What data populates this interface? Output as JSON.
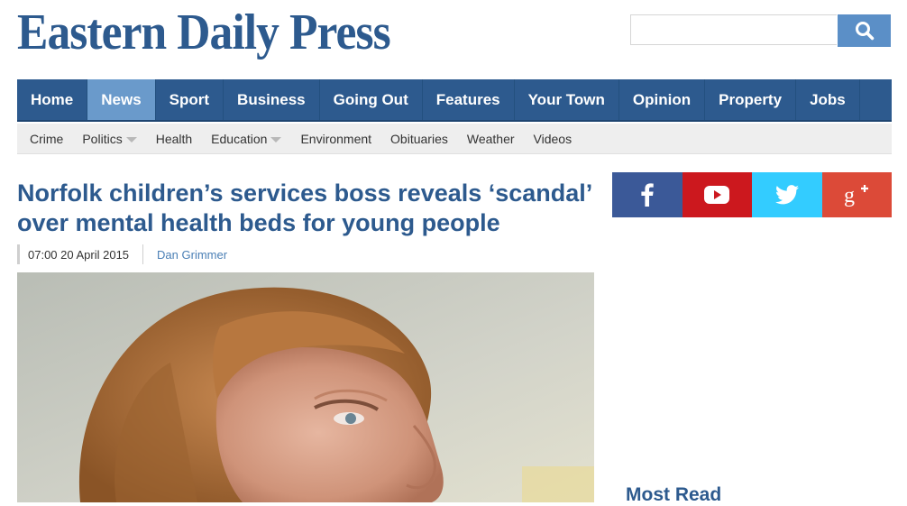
{
  "site": {
    "logo_text": "Eastern Daily Press"
  },
  "search": {
    "placeholder": "",
    "button_icon": "search-icon"
  },
  "main_nav": {
    "items": [
      {
        "label": "Home"
      },
      {
        "label": "News",
        "active": true
      },
      {
        "label": "Sport"
      },
      {
        "label": "Business"
      },
      {
        "label": "Going Out"
      },
      {
        "label": "Features"
      },
      {
        "label": "Your Town"
      },
      {
        "label": "Opinion"
      },
      {
        "label": "Property"
      },
      {
        "label": "Jobs"
      }
    ]
  },
  "sub_nav": {
    "items": [
      {
        "label": "Crime"
      },
      {
        "label": "Politics",
        "has_dropdown": true
      },
      {
        "label": "Health"
      },
      {
        "label": "Education",
        "has_dropdown": true
      },
      {
        "label": "Environment"
      },
      {
        "label": "Obituaries"
      },
      {
        "label": "Weather"
      },
      {
        "label": "Videos"
      }
    ]
  },
  "article": {
    "headline": "Norfolk children’s services boss reveals ‘scandal’ over mental health beds for young people",
    "date": "07:00 20 April 2015",
    "author": "Dan Grimmer"
  },
  "social": {
    "buttons": [
      {
        "name": "facebook",
        "icon": "facebook-icon",
        "color": "#3b5998"
      },
      {
        "name": "youtube",
        "icon": "youtube-icon",
        "color": "#cc181e"
      },
      {
        "name": "twitter",
        "icon": "twitter-icon",
        "color": "#33ccff"
      },
      {
        "name": "googleplus",
        "icon": "google-plus-icon",
        "color": "#dc4a38"
      }
    ]
  },
  "sidebar": {
    "most_read_title": "Most Read"
  },
  "colors": {
    "brand": "#2d5a8e",
    "nav_active": "#6a9acb",
    "search_button": "#5b8fc7",
    "subnav_bg": "#eeeeee"
  }
}
